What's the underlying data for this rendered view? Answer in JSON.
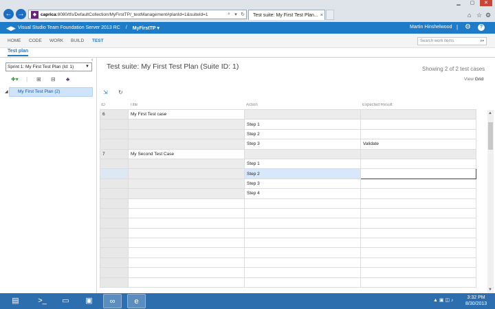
{
  "browser": {
    "url_host": "caprica",
    "url_rest": ":8080/tfs/DefaultCollection/MyFirstTP/_testManagement#planId=1&suiteId=1",
    "tab_title": "Test suite: My First Test Plan...",
    "tab_close": "×",
    "new_tab": ""
  },
  "header": {
    "product": "Visual Studio Team Foundation Server 2013 RC",
    "separator": "/",
    "project": "MyFirstTP ▾",
    "user": "Martin Hinshelwood",
    "divider": "|",
    "help": "?"
  },
  "hubs": [
    "HOME",
    "CODE",
    "WORK",
    "BUILD",
    "TEST"
  ],
  "search": {
    "placeholder": "Search work items"
  },
  "subnav": {
    "active": "Test plan"
  },
  "left": {
    "plan_select": "Sprint 1: My First Test Plan (Id: 1)",
    "tree_item": "My First Test Plan (2)"
  },
  "main": {
    "suite_title": "Test suite: My First Test Plan (Suite ID: 1)",
    "showing": "Showing 2 of 2 test cases",
    "view_label": "View",
    "view_value": "Grid"
  },
  "grid": {
    "columns": [
      "ID",
      "Title",
      "Action",
      "Expected Result"
    ],
    "rows": [
      {
        "id": "6",
        "title": "My First Test case",
        "action": "",
        "expected": ""
      },
      {
        "id": "",
        "title": "",
        "action": "Step 1",
        "expected": ""
      },
      {
        "id": "",
        "title": "",
        "action": "Step 2",
        "expected": ""
      },
      {
        "id": "",
        "title": "",
        "action": "Step 3",
        "expected": "Validate"
      },
      {
        "id": "7",
        "title": "My Second Test Case",
        "action": "",
        "expected": ""
      },
      {
        "id": "",
        "title": "",
        "action": "Step 1",
        "expected": ""
      },
      {
        "id": "",
        "title": "",
        "action": "Step 2",
        "expected": ""
      },
      {
        "id": "",
        "title": "",
        "action": "Step 3",
        "expected": ""
      },
      {
        "id": "",
        "title": "",
        "action": "Step 4",
        "expected": ""
      },
      {
        "id": "",
        "title": "",
        "action": "",
        "expected": ""
      },
      {
        "id": "",
        "title": "",
        "action": "",
        "expected": ""
      },
      {
        "id": "",
        "title": "",
        "action": "",
        "expected": ""
      },
      {
        "id": "",
        "title": "",
        "action": "",
        "expected": ""
      },
      {
        "id": "",
        "title": "",
        "action": "",
        "expected": ""
      },
      {
        "id": "",
        "title": "",
        "action": "",
        "expected": ""
      },
      {
        "id": "",
        "title": "",
        "action": "",
        "expected": ""
      },
      {
        "id": "",
        "title": "",
        "action": "",
        "expected": ""
      },
      {
        "id": "",
        "title": "",
        "action": "",
        "expected": ""
      }
    ]
  },
  "taskbar": {
    "time": "3:32 PM",
    "date": "8/30/2013"
  },
  "colors": {
    "accent": "#1e7bc7",
    "vs_purple": "#68217a",
    "taskbar": "#2d6fae"
  }
}
